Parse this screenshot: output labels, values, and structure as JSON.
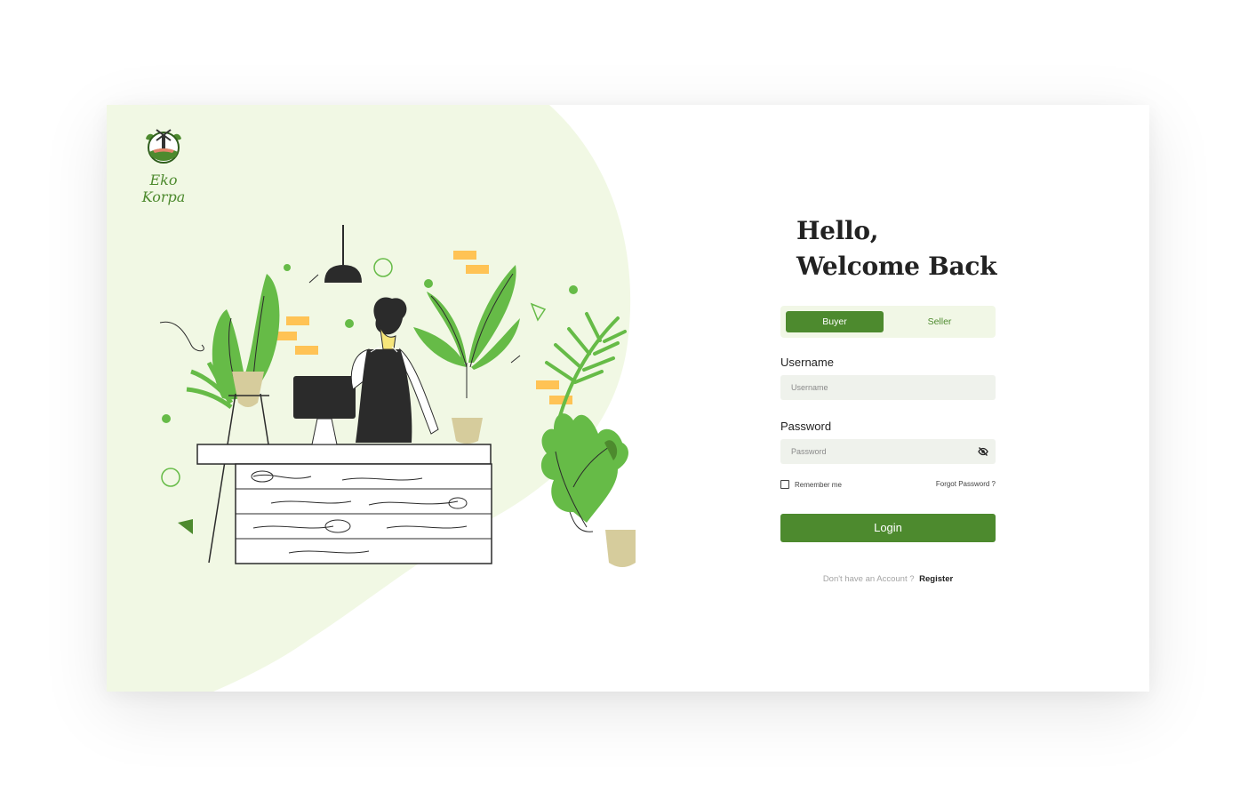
{
  "brand": {
    "name": "Eko Korpa",
    "logo_icon": "windmill-logo-icon",
    "accent_color": "#4d8a2e",
    "background_tint": "#f1f8e4"
  },
  "illustration": {
    "name": "shopkeeper-with-plants-illustration"
  },
  "greeting": {
    "line1": "Hello,",
    "line2": "Welcome Back"
  },
  "role_toggle": {
    "buyer_label": "Buyer",
    "seller_label": "Seller",
    "selected": "Buyer"
  },
  "form": {
    "username_label": "Username",
    "username_placeholder": "Username",
    "password_label": "Password",
    "password_placeholder": "Password",
    "password_toggle_icon": "eye-off-icon",
    "remember_label": "Remember me",
    "forgot_label": "Forgot Password ?",
    "login_label": "Login"
  },
  "footer": {
    "prompt": "Don't have an Account ?",
    "register_label": "Register"
  }
}
